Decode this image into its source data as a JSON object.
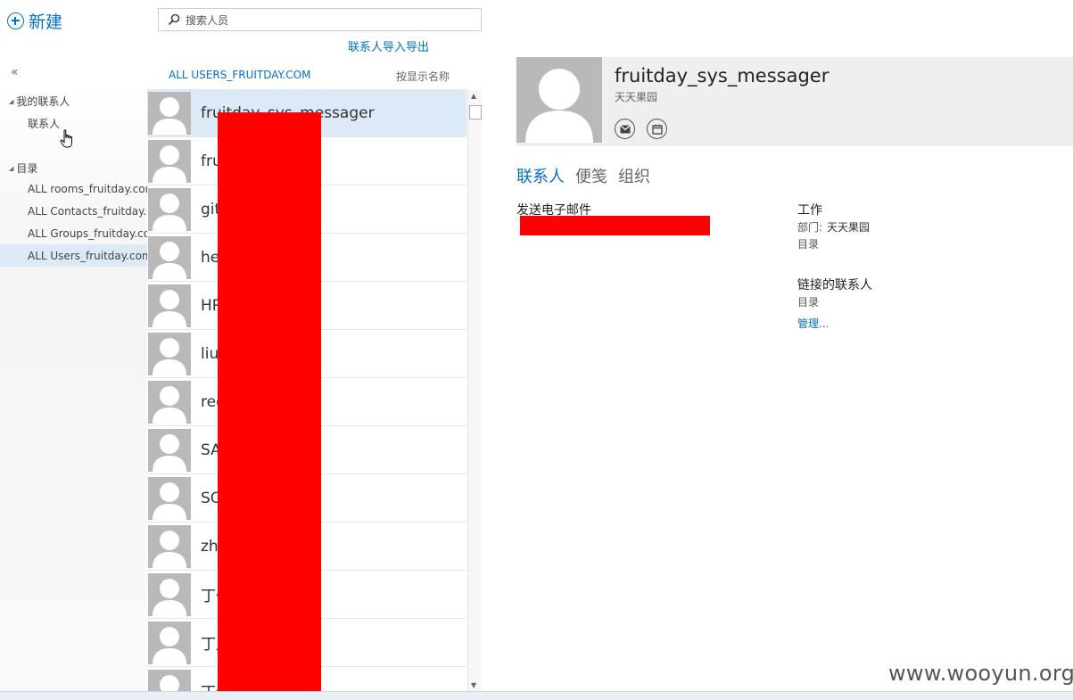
{
  "app": {
    "new_label": "新建",
    "collapse_glyph": "«"
  },
  "nav": {
    "my_contacts": "我的联系人",
    "contacts": "联系人",
    "directory": "目录",
    "directory_items": [
      "ALL rooms_fruitday.com",
      "ALL Contacts_fruitday.com",
      "ALL Groups_fruitday.com",
      "ALL Users_fruitday.com"
    ],
    "selected_index": 3
  },
  "search": {
    "placeholder": "搜索人员",
    "icon": "search-icon"
  },
  "import_export": "联系人导入导出",
  "list": {
    "title": "ALL USERS_FRUITDAY.COM",
    "sort": "按显示名称",
    "rows": [
      "fruitday_sys_messager",
      "fru",
      "git",
      "hey",
      "HR",
      "liu",
      "red",
      "SA",
      "SO",
      "zha",
      "丁伯",
      "丁月",
      "丁还"
    ],
    "selected_index": 0
  },
  "detail": {
    "name": "fruitday_sys_messager",
    "org": "天天果园",
    "tabs": [
      "联系人",
      "便笺",
      "组织"
    ],
    "send_email": "发送电子邮件",
    "work_title": "工作",
    "department_label": "部门:",
    "department_value": "天天果园",
    "directory": "目录",
    "linked_title": "链接的联系人",
    "linked_directory": "目录",
    "manage": "管理..."
  },
  "watermark": "www.wooyun.org",
  "colors": {
    "accent": "#0072c6",
    "selection": "#dce9f7",
    "redaction": "#ff0000",
    "avatar": "#b9b9b9"
  }
}
